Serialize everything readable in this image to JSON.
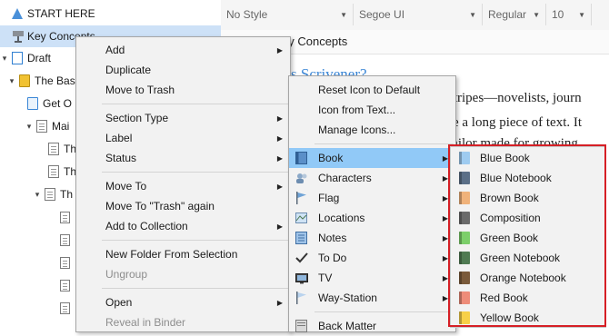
{
  "binder": {
    "items": [
      {
        "label": "START HERE",
        "toggle": "",
        "icon": "start-here-icon"
      },
      {
        "label": "Key Concepts",
        "toggle": "",
        "icon": "key-concepts-icon"
      },
      {
        "label": "Draft",
        "toggle": "▾",
        "icon": "draft-icon"
      },
      {
        "label": "The Bas",
        "toggle": "▾",
        "icon": "folder-icon"
      },
      {
        "label": "Get O",
        "toggle": "",
        "icon": "document-icon"
      },
      {
        "label": "Mai",
        "toggle": "▾",
        "icon": "document-stack-icon"
      },
      {
        "label": "Th",
        "toggle": "",
        "icon": "document-icon"
      },
      {
        "label": "Th",
        "toggle": "",
        "icon": "document-icon"
      },
      {
        "label": "Th",
        "toggle": "▾",
        "icon": "document-stack-icon"
      }
    ]
  },
  "format_bar": {
    "style": "No Style",
    "font": "Segoe UI",
    "weight": "Regular",
    "size": "10"
  },
  "editor": {
    "header_title": "ey Concepts",
    "heading_fragment": "s Scrivener?",
    "lines": [
      "stripes—novelists, journ",
      "re a long piece of text. It",
      "tailor made for growing"
    ]
  },
  "menu_main": {
    "items": [
      {
        "label": "Add",
        "submenu": true,
        "disabled": false
      },
      {
        "label": "Duplicate",
        "submenu": false,
        "disabled": false
      },
      {
        "label": "Move to Trash",
        "submenu": false,
        "disabled": false
      },
      {
        "label": "Section Type",
        "submenu": true,
        "disabled": false
      },
      {
        "label": "Label",
        "submenu": true,
        "disabled": false
      },
      {
        "label": "Status",
        "submenu": true,
        "disabled": false
      },
      {
        "label": "Move To",
        "submenu": true,
        "disabled": false
      },
      {
        "label": "Move To \"Trash\" again",
        "submenu": false,
        "disabled": false
      },
      {
        "label": "Add to Collection",
        "submenu": true,
        "disabled": false
      },
      {
        "label": "New Folder From Selection",
        "submenu": false,
        "disabled": false
      },
      {
        "label": "Ungroup",
        "submenu": false,
        "disabled": true
      },
      {
        "label": "Open",
        "submenu": true,
        "disabled": false
      },
      {
        "label": "Reveal in Binder",
        "submenu": false,
        "disabled": true
      }
    ]
  },
  "menu_icon": {
    "items": [
      {
        "label": "Reset Icon to Default"
      },
      {
        "label": "Icon from Text..."
      },
      {
        "label": "Manage Icons..."
      },
      {
        "label": "Book",
        "icon": "book-icon",
        "highlighted": true
      },
      {
        "label": "Characters",
        "icon": "characters-icon"
      },
      {
        "label": "Flag",
        "icon": "flag-icon"
      },
      {
        "label": "Locations",
        "icon": "locations-icon"
      },
      {
        "label": "Notes",
        "icon": "notes-icon"
      },
      {
        "label": "To Do",
        "icon": "checkmark-icon"
      },
      {
        "label": "TV",
        "icon": "tv-icon"
      },
      {
        "label": "Way-Station",
        "icon": "way-station-flag-icon"
      },
      {
        "label": "Back Matter",
        "icon": "back-matter-icon"
      }
    ]
  },
  "menu_book": {
    "items": [
      {
        "label": "Blue Book",
        "color": "#9ecbf0"
      },
      {
        "label": "Blue Notebook",
        "color": "#5b6f87"
      },
      {
        "label": "Brown Book",
        "color": "#f0b27a"
      },
      {
        "label": "Composition",
        "color": "#6a6a6a"
      },
      {
        "label": "Green Book",
        "color": "#7ccf6a"
      },
      {
        "label": "Green Notebook",
        "color": "#4f7a52"
      },
      {
        "label": "Orange Notebook",
        "color": "#7a5a3a"
      },
      {
        "label": "Red Book",
        "color": "#ee8c79"
      },
      {
        "label": "Yellow Book",
        "color": "#f7d048"
      }
    ]
  },
  "colors": {
    "highlight": "#91c9f7",
    "selected_row": "#cde1f7",
    "red_annotation": "#d61f26"
  }
}
